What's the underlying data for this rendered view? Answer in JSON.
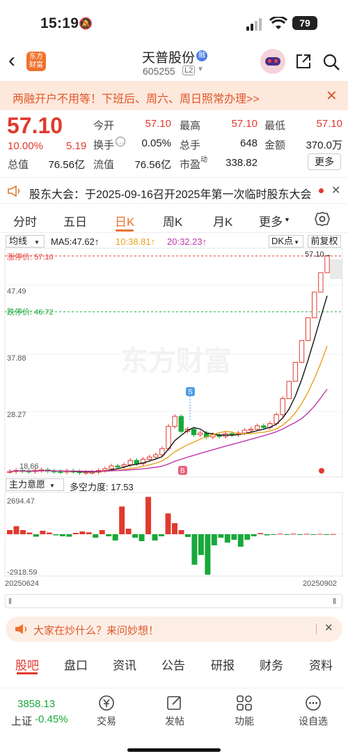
{
  "status": {
    "time": "15:19",
    "battery": "79"
  },
  "header": {
    "stock_name": "天普股份",
    "stock_code": "605255",
    "level_badge": "L2",
    "logo_text_1": "东方",
    "logo_text_2": "财富",
    "margin_badge": "融"
  },
  "banner": {
    "text": "两融开户不用等！下班后、周六、周日照常办理>>"
  },
  "quote": {
    "price": "57.10",
    "pct": "10.00%",
    "change": "5.19",
    "open_label": "今开",
    "open": "57.10",
    "high_label": "最高",
    "high": "57.10",
    "low_label": "最低",
    "low": "57.10",
    "turnover_label": "换手",
    "turnover": "0.05%",
    "volume_label": "总手",
    "volume": "648",
    "amount_label": "金额",
    "amount": "370.0万",
    "mktcap_label": "总值",
    "mktcap": "76.56亿",
    "float_label": "流值",
    "float": "76.56亿",
    "pe_label": "市盈",
    "pe_sup": "动",
    "pe": "338.82",
    "more": "更多"
  },
  "notice": {
    "text": "股东大会：于2025-09-16召开2025年第一次临时股东大会"
  },
  "tabs": [
    "分时",
    "五日",
    "日K",
    "周K",
    "月K",
    "更多"
  ],
  "active_tab": "日K",
  "chart_labels": {
    "ma_select": "均线",
    "ma5": "MA5:47.62↑",
    "ma10": "10:38.81↑",
    "ma20": "20:32.23↑",
    "dk": "DK点",
    "adjust": "前复权",
    "limit_up_label": "涨停价: 57.10",
    "limit_down_label": "跌停价: 46.72",
    "y_top": "57.10",
    "y1": "47.49",
    "y2": "37.88",
    "y3": "28.27",
    "y_low": "18.66",
    "last_price": "57.10→",
    "ind_select": "主力意愿",
    "ind_value": "多空力度: 17.53",
    "ind_max": "2694.47",
    "ind_min": "-2918.59",
    "date_start": "20250624",
    "date_end": "20250902",
    "s_mark": "S",
    "b_mark": "B",
    "watermark": "东方财富"
  },
  "chart_data": {
    "type": "candlestick",
    "x_start": "20250624",
    "x_end": "20250902",
    "y_ticks": [
      57.1,
      47.49,
      37.88,
      28.27,
      18.66
    ],
    "limit_up": 57.1,
    "limit_down": 46.72,
    "ma5": 47.62,
    "ma10": 38.81,
    "ma20": 32.23,
    "closes": [
      18.4,
      18.6,
      18.5,
      18.4,
      18.6,
      18.7,
      18.5,
      18.4,
      18.3,
      18.5,
      18.4,
      18.2,
      18.3,
      18.3,
      18.6,
      18.9,
      19.4,
      19.3,
      19.6,
      20.4,
      19.8,
      20.6,
      21.0,
      21.4,
      22.5,
      26.5,
      28.3,
      25.6,
      26.0,
      25.0,
      25.3,
      24.6,
      25.0,
      24.7,
      25.2,
      25.0,
      25.3,
      25.8,
      26.0,
      26.6,
      26.3,
      27.0,
      28.6,
      31.5,
      34.6,
      38.0,
      41.9,
      46.0,
      50.6,
      54.1,
      57.1
    ],
    "indicator": {
      "name": "多空力度",
      "value": 17.53,
      "max": 2694.47,
      "min": -2918.59,
      "bars": [
        300,
        580,
        300,
        120,
        -180,
        250,
        120,
        -80,
        -150,
        -180,
        100,
        200,
        140,
        -250,
        300,
        -150,
        -450,
        2000,
        400,
        -250,
        -500,
        2694,
        -450,
        -150,
        1500,
        800,
        300,
        -200,
        -2200,
        -1500,
        -2918.59,
        -800,
        -250,
        -600,
        -400,
        -900,
        -400,
        -150,
        80,
        -80,
        -50,
        40,
        -40,
        40,
        -40,
        30,
        -30,
        20,
        -20,
        15
      ]
    }
  },
  "bottom_tabs": [
    "股吧",
    "盘口",
    "资讯",
    "公告",
    "研报",
    "财务",
    "资料"
  ],
  "promo": {
    "text": "大家在炒什么？来问妙想！"
  },
  "footer": {
    "index_value": "3858.13",
    "index_name": "上证",
    "index_pct": "-0.45%",
    "items": [
      "交易",
      "发帖",
      "功能",
      "设自选"
    ]
  },
  "colors": {
    "up": "#e03a2f",
    "down": "#18a83a",
    "accent": "#f0712c",
    "banner_bg": "#fde8dc"
  }
}
